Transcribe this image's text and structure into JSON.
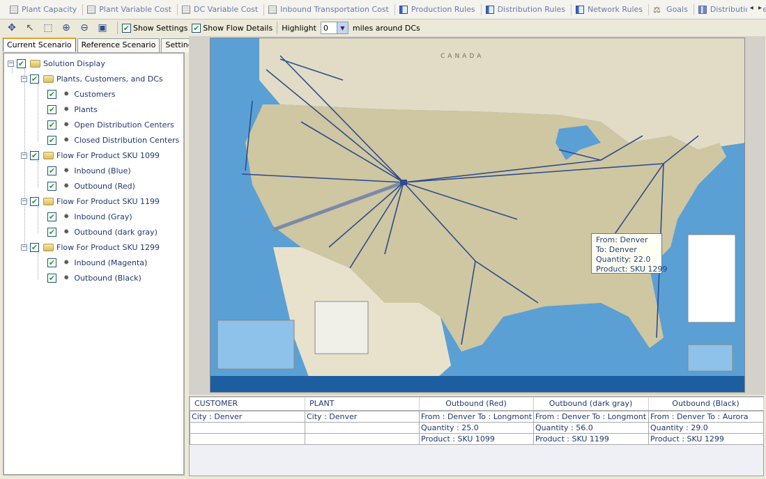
{
  "doc_tabs": [
    {
      "label": "Plant Capacity",
      "icon": "table-icon"
    },
    {
      "label": "Plant Variable Cost",
      "icon": "table-icon"
    },
    {
      "label": "DC Variable Cost",
      "icon": "table-icon"
    },
    {
      "label": "Inbound Transportation Cost",
      "icon": "table-icon"
    },
    {
      "label": "Production Rules",
      "icon": "rules-icon"
    },
    {
      "label": "Distribution Rules",
      "icon": "rules-icon"
    },
    {
      "label": "Network Rules",
      "icon": "rules-icon"
    },
    {
      "label": "Goals",
      "icon": "goals-icon"
    },
    {
      "label": "Distribution Center Cha",
      "icon": "chart-icon"
    }
  ],
  "toolbar": {
    "show_settings_label": "Show Settings",
    "show_settings_checked": true,
    "show_flow_details_label": "Show Flow Details",
    "show_flow_details_checked": true,
    "highlight_label": "Highlight",
    "highlight_value": "0",
    "miles_label": "miles around DCs",
    "icons": [
      "pan-icon",
      "pointer-icon",
      "select-region-icon",
      "zoom-in-icon",
      "zoom-out-icon",
      "zoom-fit-icon"
    ]
  },
  "left_tabs": [
    "Current Scenario",
    "Reference Scenario",
    "Settings"
  ],
  "tree": {
    "root": "Solution Display",
    "groups": [
      {
        "label": "Plants, Customers, and DCs",
        "items": [
          "Customers",
          "Plants",
          "Open Distribution Centers",
          "Closed Distribution Centers"
        ]
      },
      {
        "label": "Flow For Product SKU 1099",
        "items": [
          "Inbound (Blue)",
          "Outbound (Red)"
        ]
      },
      {
        "label": "Flow For Product SKU 1199",
        "items": [
          "Inbound (Gray)",
          "Outbound (dark gray)"
        ]
      },
      {
        "label": "Flow For Product SKU 1299",
        "items": [
          "Inbound (Magenta)",
          "Outbound (Black)"
        ]
      }
    ]
  },
  "map": {
    "country_label": "CANADA",
    "hub_city": "Denver",
    "tooltip": {
      "from": "From: Denver",
      "to": "To: Denver",
      "quantity": "Quantity: 22.0",
      "product": "Product: SKU 1299"
    },
    "colors": {
      "ocean": "#5aa0d4",
      "land": "#cfc6a2",
      "flow": "#2c4d8c"
    }
  },
  "table": {
    "headers": [
      "CUSTOMER",
      "PLANT",
      "Outbound (Red)",
      "Outbound (dark gray)",
      "Outbound (Black)"
    ],
    "rows": [
      [
        "City : Denver",
        "City : Denver",
        "From : Denver  To : Longmont",
        "From : Denver  To : Longmont",
        "From : Denver  To : Aurora"
      ],
      [
        "",
        "",
        "Quantity : 25.0",
        "Quantity : 56.0",
        "Quantity : 29.0"
      ],
      [
        "",
        "",
        "Product : SKU 1099",
        "Product : SKU 1199",
        "Product : SKU 1299"
      ]
    ]
  }
}
